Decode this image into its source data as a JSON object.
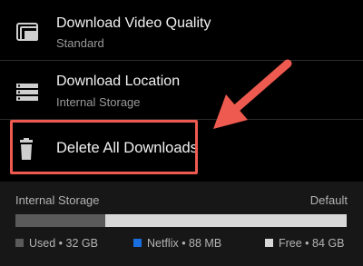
{
  "settings": {
    "download_quality": {
      "title": "Download Video Quality",
      "value": "Standard",
      "icon": "video-quality-icon"
    },
    "download_location": {
      "title": "Download Location",
      "value": "Internal Storage",
      "icon": "storage-location-icon"
    },
    "delete_all": {
      "title": "Delete All Downloads",
      "icon": "trash-icon"
    }
  },
  "storage": {
    "label": "Internal Storage",
    "default_label": "Default",
    "bar_fractions": {
      "used": 0.27,
      "netflix": 0.002,
      "free": 0.728
    },
    "legend": [
      {
        "key": "used",
        "text": "Used • 32 GB",
        "color": "#5a5a5a"
      },
      {
        "key": "netflix",
        "text": "Netflix • 88 MB",
        "color": "#1a6fe0"
      },
      {
        "key": "free",
        "text": "Free • 84 GB",
        "color": "#d8d8d8"
      }
    ]
  },
  "colors": {
    "accent_annotation": "#ee5a4f",
    "background": "#000000",
    "storage_panel": "#171717"
  }
}
